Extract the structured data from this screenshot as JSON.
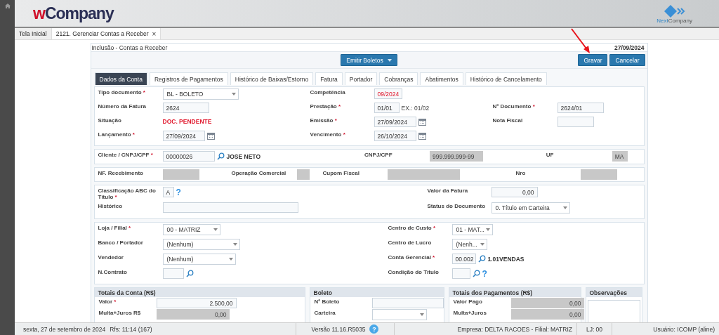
{
  "header": {
    "logo_accent": "w",
    "logo_rest": "Company",
    "brand_accent": "Next",
    "brand_rest": "Company"
  },
  "tabs": [
    {
      "label": "Tela Inicial",
      "selected": false
    },
    {
      "label": "2121. Gerenciar Contas a Receber",
      "selected": true,
      "close": "×"
    }
  ],
  "form": {
    "title": "Inclusão - Contas a Receber",
    "date": "27/09/2024",
    "emit_button": "Emitir Boletos",
    "actions": [
      "Gravar",
      "Cancelar"
    ]
  },
  "subtabs": [
    {
      "label": "Dados da Conta",
      "selected": true
    },
    {
      "label": "Registros de Pagamentos",
      "selected": false
    },
    {
      "label": "Histórico de Baixas/Estorno",
      "selected": false
    },
    {
      "label": "Fatura",
      "selected": false
    },
    {
      "label": "Portador",
      "selected": false
    },
    {
      "label": "Cobranças",
      "selected": false
    },
    {
      "label": "Abatimentos",
      "selected": false
    },
    {
      "label": "Histórico de Cancelamento",
      "selected": false
    }
  ],
  "sections": [
    {
      "rows": [
        [
          {
            "label": "Tipo documento",
            "mark": "*",
            "kind": "select",
            "value": "BL - BOLETO"
          },
          {
            "label": "Competência",
            "kind": "text",
            "value": "09/2024",
            "alert": true
          }
        ],
        [
          {
            "label": "Número da Fatura",
            "kind": "text",
            "value": "2624"
          },
          {
            "label": "Prestação",
            "mark": "*",
            "kind": "text",
            "value": "01/01",
            "hint": "EX.: 01/02"
          },
          {
            "label": "Nº Documento",
            "mark": "*",
            "kind": "text",
            "value": "2624/01"
          }
        ],
        [
          {
            "label": "Situação",
            "kind": "status",
            "value": "DOC. PENDENTE"
          },
          {
            "label": "Emissão",
            "mark": "*",
            "kind": "date",
            "value": "27/09/2024"
          },
          {
            "label": "Nota Fiscal",
            "kind": "text"
          }
        ],
        [
          {
            "label": "Lançamento",
            "mark": "*",
            "kind": "date",
            "value": "27/09/2024"
          },
          {
            "label": "Vencimento",
            "mark": "*",
            "kind": "date",
            "value": "26/10/2024"
          }
        ]
      ]
    },
    {
      "rows": [
        [
          {
            "label": "Cliente / CNPJ/CPF",
            "mark": "*",
            "kind": "search",
            "value": "00000026",
            "name": "JOSE NETO"
          },
          {
            "label": "CNPJ/CPF",
            "kind": "readonly",
            "value": "999.999.999-99"
          },
          {
            "label": "UF",
            "kind": "readonly",
            "value": "MA"
          }
        ]
      ]
    },
    {
      "rows": [
        [
          {
            "label": "NF. Recebimento",
            "kind": "readonly"
          },
          {
            "label": "Operação Comercial",
            "kind": "readonly"
          },
          {
            "label": "Cupom Fiscal",
            "kind": "readonly"
          },
          {
            "label": "Nro",
            "kind": "readonly"
          }
        ]
      ]
    },
    {
      "rows": [
        [
          {
            "label": "Classificação ABC do Título",
            "mark": "*",
            "kind": "text",
            "value": "A",
            "help": "?"
          },
          {
            "label": "Valor da Fatura",
            "kind": "number",
            "value": "0,00"
          }
        ],
        [
          {
            "label": "Histórico",
            "kind": "text"
          },
          {
            "label": "Status do Documento",
            "kind": "select",
            "value": "0. Título em Carteira"
          }
        ]
      ]
    },
    {
      "rows": [
        [
          {
            "label": "Loja / Filial",
            "mark": "*",
            "kind": "select",
            "value": "00 - MATRIZ"
          },
          {
            "label": "Centro de Custo",
            "mark": "*",
            "kind": "select",
            "value": "01 - MAT..."
          }
        ],
        [
          {
            "label": "Banco / Portador",
            "kind": "select",
            "value": "(Nenhum)"
          },
          {
            "label": "Centro de Lucro",
            "kind": "select",
            "value": "(Nenh..."
          }
        ],
        [
          {
            "label": "Vendedor",
            "kind": "select",
            "value": "(Nenhum)"
          },
          {
            "label": "Conta Gerencial",
            "mark": "*",
            "kind": "search",
            "value": "00.002",
            "name": "1.01VENDAS"
          }
        ],
        [
          {
            "label": "N.Contrato",
            "kind": "search"
          },
          {
            "label": "Condição do Título",
            "kind": "search",
            "help": "?"
          }
        ]
      ]
    }
  ],
  "panels": [
    {
      "title": "Totais da Conta (R$)",
      "rows": [
        {
          "label": "Valor",
          "mark": "*",
          "kind": "number",
          "value": "2.500,00"
        },
        {
          "label": "Multa+Juros R$",
          "kind": "readonly",
          "value": "0,00"
        }
      ]
    },
    {
      "title": "Boleto",
      "rows": [
        {
          "label": "Nº Boleto",
          "kind": "text"
        },
        {
          "label": "Carteira",
          "kind": "select"
        }
      ]
    },
    {
      "title": "Totais dos Pagamentos (R$)",
      "rows": [
        {
          "label": "Valor Pago",
          "kind": "readonly",
          "value": "0,00"
        },
        {
          "label": "Multa+Juros",
          "kind": "readonly",
          "value": "0,00"
        }
      ]
    },
    {
      "title": "Observações",
      "rows": [
        {
          "kind": "textarea"
        }
      ]
    }
  ],
  "status_bar": {
    "date": "sexta, 27 de setembro de 2024",
    "refresh": "Rfs: 11:14 (167)",
    "version": "Versão 11.16.R5035",
    "help": "?",
    "company": "Empresa: DELTA RACOES - Filial: MATRIZ",
    "store": "LJ: 00",
    "user": "Usuário: ICOMP (aline)"
  }
}
